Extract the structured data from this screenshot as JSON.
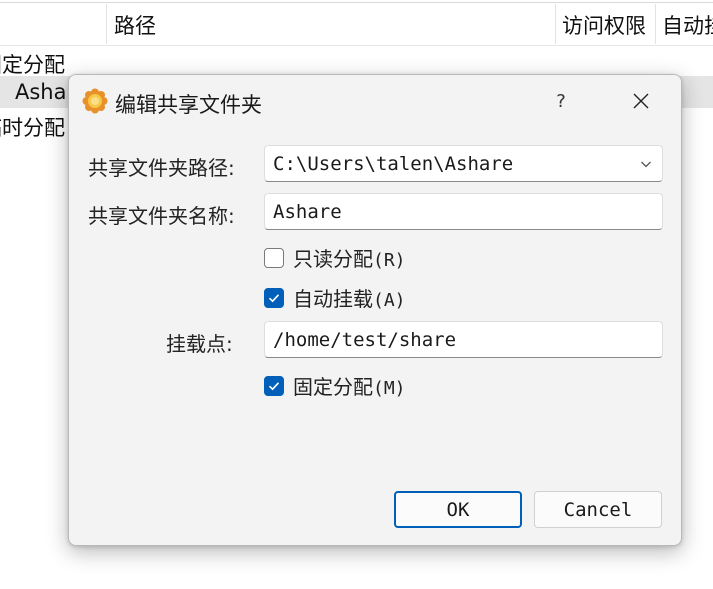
{
  "background": {
    "columns": {
      "path": "路径",
      "access": "访问权限",
      "automount": "自动挂"
    },
    "rows": {
      "fixed_group": "固定分配",
      "selected_item": "Ashare",
      "temp_group": "临时分配"
    }
  },
  "dialog": {
    "title": "编辑共享文件夹",
    "help_label": "?",
    "close_label": "✕",
    "path_label": "共享文件夹路径:",
    "path_value": "C:\\Users\\talen\\Ashare",
    "name_label": "共享文件夹名称:",
    "name_value": "Ashare",
    "readonly": {
      "label": "只读分配",
      "shortcut": "(R)",
      "checked": false
    },
    "automount": {
      "label": "自动挂载",
      "shortcut": "(A)",
      "checked": true
    },
    "mountpoint_label": "挂载点:",
    "mountpoint_value": "/home/test/share",
    "permanent": {
      "label": "固定分配",
      "shortcut": "(M)",
      "checked": true
    },
    "ok_label": "OK",
    "cancel_label": "Cancel"
  },
  "colors": {
    "accent": "#005fb8",
    "dialog_bg": "#f3f3f3"
  }
}
